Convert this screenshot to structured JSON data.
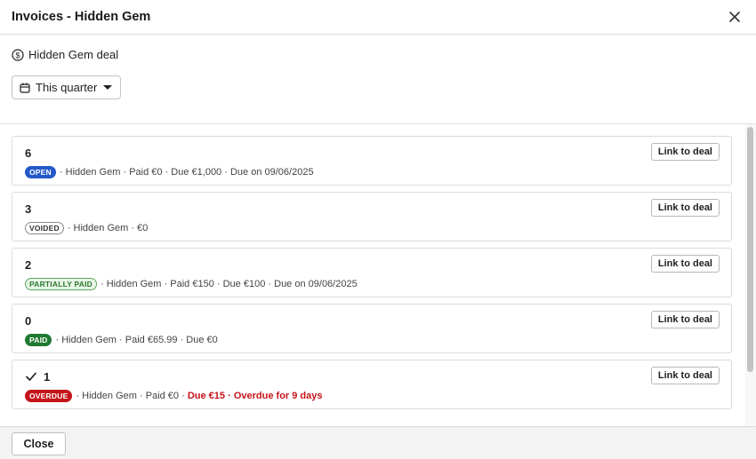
{
  "dialog": {
    "title": "Invoices - Hidden Gem"
  },
  "deal": {
    "label": "Hidden Gem deal",
    "icon": "dollar-circle-icon"
  },
  "filter": {
    "label": "This quarter",
    "icon": "calendar-icon"
  },
  "invoices": [
    {
      "number": "6",
      "status": "OPEN",
      "customer": "Hidden Gem",
      "paid": "Paid €0",
      "due": "Due €1,000",
      "due_date": "Due on 09/06/2025",
      "link_label": "Link to deal"
    },
    {
      "number": "3",
      "status": "VOIDED",
      "customer": "Hidden Gem",
      "amount": "€0",
      "link_label": "Link to deal"
    },
    {
      "number": "2",
      "status": "PARTIALLY PAID",
      "customer": "Hidden Gem",
      "paid": "Paid €150",
      "due": "Due €100",
      "due_date": "Due on 09/06/2025",
      "link_label": "Link to deal"
    },
    {
      "number": "0",
      "status": "PAID",
      "customer": "Hidden Gem",
      "paid": "Paid €65.99",
      "due": "Due €0",
      "link_label": "Link to deal"
    },
    {
      "number": "1",
      "selected": true,
      "status": "OVERDUE",
      "customer": "Hidden Gem",
      "paid": "Paid €0",
      "due": "Due €15",
      "overdue": "Overdue for 9 days",
      "link_label": "Link to deal"
    }
  ],
  "separator": "·",
  "footer": {
    "close_label": "Close"
  },
  "colors": {
    "open": "#2559c9",
    "paid": "#1f7a32",
    "overdue": "#c4141a",
    "partially_paid": "#2c7a2c"
  }
}
